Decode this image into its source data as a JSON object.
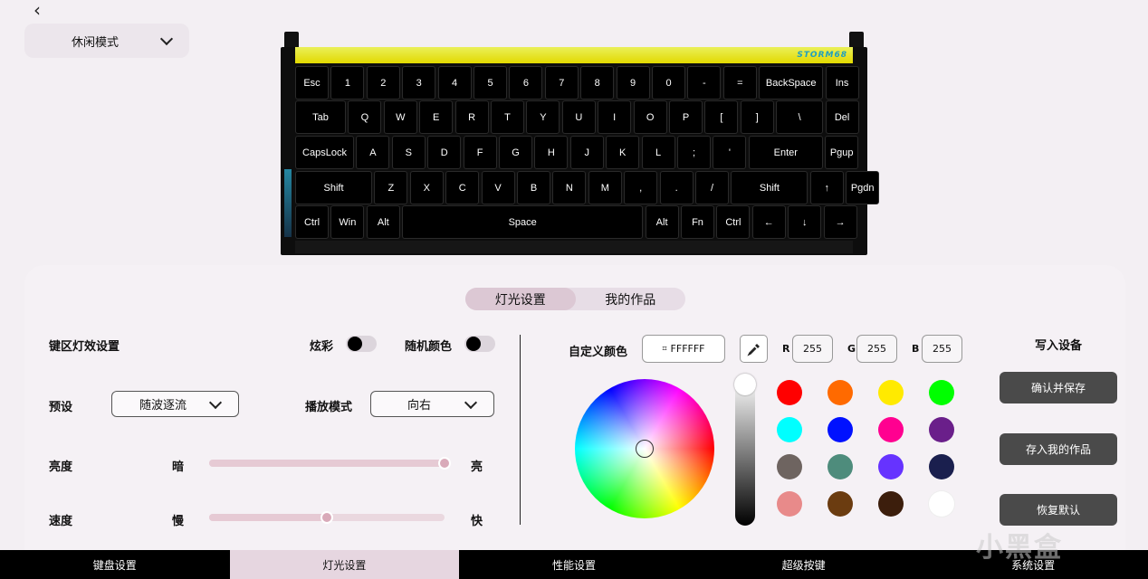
{
  "nav": {
    "mode": "休闲模式"
  },
  "keyboard": {
    "logo": "STORM68",
    "keys": [
      "Esc",
      "1",
      "2",
      "3",
      "4",
      "5",
      "6",
      "7",
      "8",
      "9",
      "0",
      "-",
      "=",
      "BackSpace",
      "Ins",
      "Tab",
      "Q",
      "W",
      "E",
      "R",
      "T",
      "Y",
      "U",
      "I",
      "O",
      "P",
      "[",
      "]",
      "\\",
      "Del",
      "CapsLock",
      "A",
      "S",
      "D",
      "F",
      "G",
      "H",
      "J",
      "K",
      "L",
      ";",
      "'",
      "Enter",
      "Pgup",
      "Shift",
      "Z",
      "X",
      "C",
      "V",
      "B",
      "N",
      "M",
      ",",
      ".",
      "/",
      "Shift",
      "↑",
      "Pgdn",
      "Ctrl",
      "Win",
      "Alt",
      "Space",
      "Alt",
      "Fn",
      "Ctrl",
      "←",
      "↓",
      "→"
    ]
  },
  "segment": {
    "light": "灯光设置",
    "works": "我的作品"
  },
  "effects": {
    "title": "键区灯效设置",
    "colorful": "炫彩",
    "random": "随机颜色",
    "preset_label": "预设",
    "preset_value": "随波逐流",
    "play_label": "播放模式",
    "play_value": "向右",
    "brightness_label": "亮度",
    "dark": "暗",
    "bright": "亮",
    "brightness_level": 1.0,
    "speed_label": "速度",
    "slow": "慢",
    "fast": "快",
    "speed_level": 0.5
  },
  "color": {
    "title": "自定义颜色",
    "hex": "FFFFFF",
    "r_label": "R",
    "r": "255",
    "g_label": "G",
    "g": "255",
    "b_label": "B",
    "b": "255",
    "swatches": [
      "#ff0000",
      "#ff6a00",
      "#ffea00",
      "#00ff00",
      "#00ffff",
      "#0011ff",
      "#ff0090",
      "#6a1f8a",
      "#6e6460",
      "#4e8c7c",
      "#6633ff",
      "#1a1f4e",
      "#e88a8a",
      "#6b3c10",
      "#3c1e0c",
      "#ffffff"
    ]
  },
  "device": {
    "title": "写入设备",
    "confirm": "确认并保存",
    "save_works": "存入我的作品",
    "reset": "恢复默认"
  },
  "tabs": [
    "键盘设置",
    "灯光设置",
    "性能设置",
    "超级按键",
    "系统设置"
  ],
  "watermark": "小黑盒"
}
